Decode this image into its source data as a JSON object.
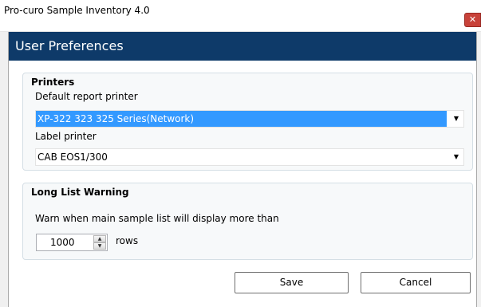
{
  "window": {
    "title": "Pro-curo Sample Inventory 4.0",
    "close_icon": "close-icon"
  },
  "dialog": {
    "header": "User Preferences",
    "colors": {
      "header_bg": "#0e3a69",
      "selection": "#3399ff"
    }
  },
  "printers": {
    "group_title": "Printers",
    "default_label": "Default report printer",
    "default_value": "XP-322 323 325 Series(Network)",
    "label_label": "Label printer",
    "label_value": "CAB EOS1/300"
  },
  "long_list": {
    "group_title": "Long List Warning",
    "description": "Warn when main sample list will display more than",
    "rows_value": "1000",
    "rows_unit": "rows"
  },
  "buttons": {
    "save": "Save",
    "cancel": "Cancel"
  }
}
